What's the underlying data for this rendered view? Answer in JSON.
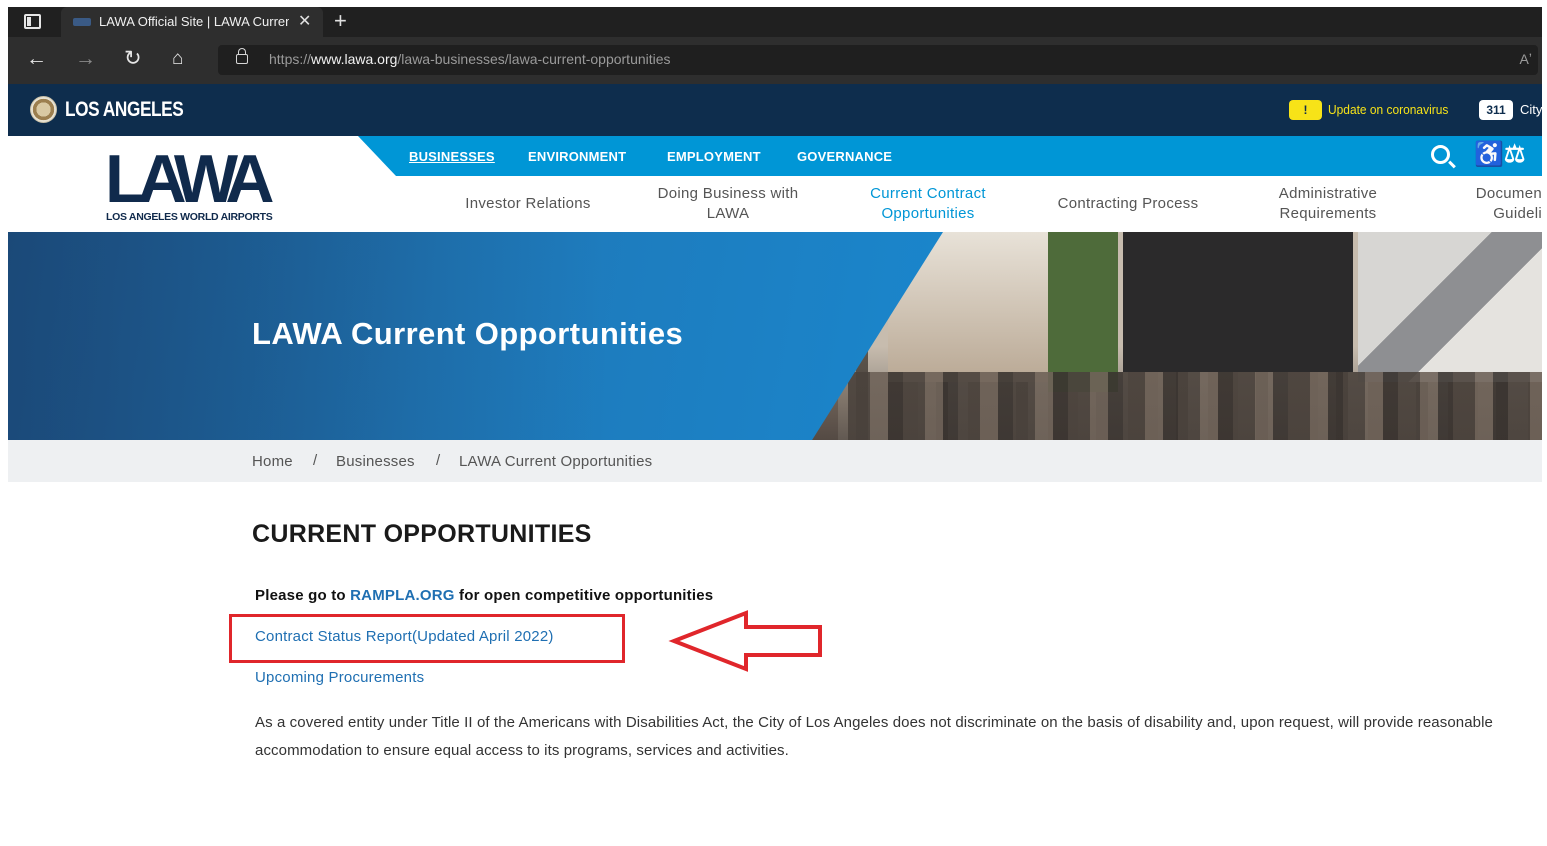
{
  "browser": {
    "tab_title": "LAWA Official Site | LAWA Curren",
    "url_scheme": "https://",
    "url_host": "www.lawa.org",
    "url_path": "/lawa-businesses/lawa-current-opportunities",
    "read_aloud": "Aʼ"
  },
  "citybar": {
    "city_name": "LOS ANGELES",
    "covid_badge": "!",
    "covid_link": "Update on coronavirus",
    "badge_311": "311",
    "city_link": "City"
  },
  "header": {
    "logo_main": "LAWA",
    "logo_sub": "LOS ANGELES WORLD AIRPORTS",
    "topnav": [
      {
        "label": "BUSINESSES"
      },
      {
        "label": "ENVIRONMENT"
      },
      {
        "label": "EMPLOYMENT"
      },
      {
        "label": "GOVERNANCE"
      }
    ],
    "subnav": [
      {
        "label": "Investor Relations"
      },
      {
        "label1": "Doing Business with",
        "label2": "LAWA"
      },
      {
        "label1": "Current Contract",
        "label2": "Opportunities"
      },
      {
        "label": "Contracting Process"
      },
      {
        "label1": "Administrative",
        "label2": "Requirements"
      },
      {
        "label1": "Documen",
        "label2": "Guideli"
      }
    ],
    "access_icons": "♿⚖"
  },
  "hero": {
    "title": "LAWA Current Opportunities"
  },
  "breadcrumb": {
    "items": [
      "Home",
      "Businesses",
      "LAWA Current Opportunities"
    ],
    "separator": "/"
  },
  "content": {
    "heading": "CURRENT OPPORTUNITIES",
    "intro_before": "Please go to ",
    "intro_link": "RAMPLA.ORG",
    "intro_after": " for open competitive opportunities",
    "link_contract_status": "Contract Status Report(Updated April 2022)",
    "link_upcoming": "Upcoming Procurements",
    "ada_text": "As a covered entity under Title II of the Americans with Disabilities Act, the City of Los Angeles does not discriminate on the basis of disability and, upon request, will provide reasonable accommodation to ensure equal access to its programs, services and activities."
  },
  "colors": {
    "city_bar": "#0e2d4d",
    "nav_blue": "#0096d6",
    "link_blue": "#1f6fb2",
    "annotation_red": "#e0262b",
    "covid_yellow": "#f7e318"
  }
}
